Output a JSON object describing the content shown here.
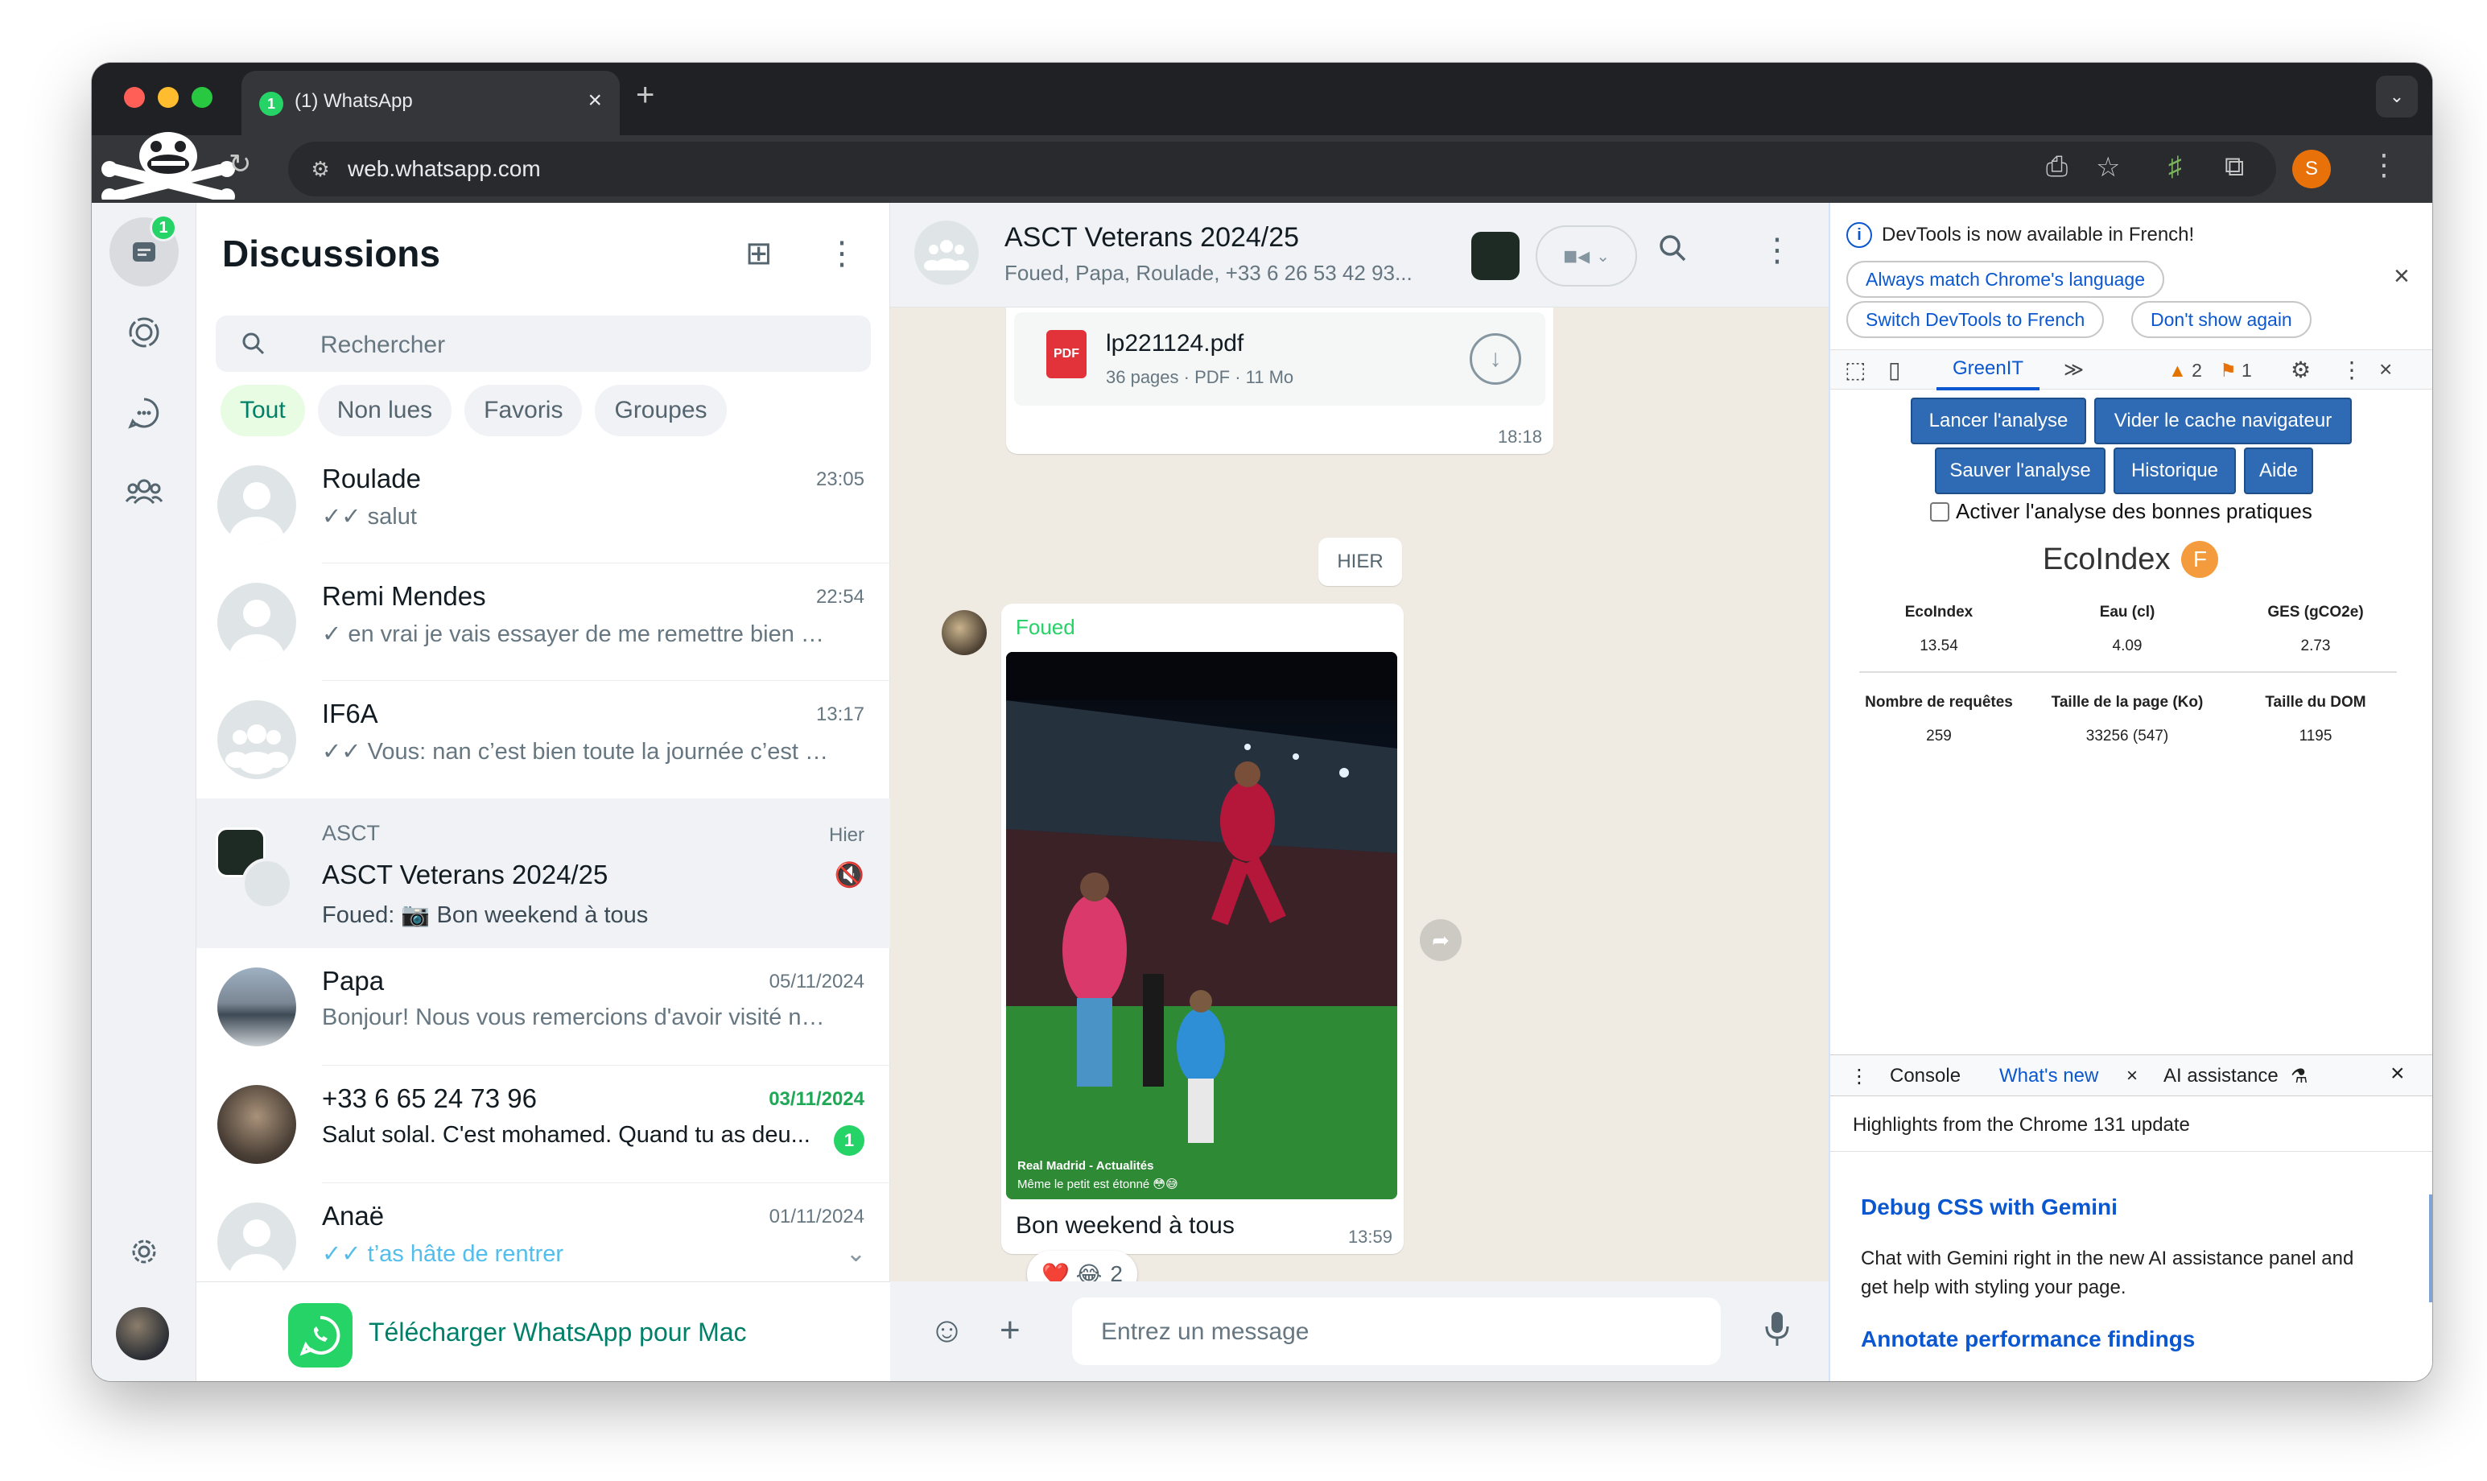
{
  "browser": {
    "tab_title": "(1) WhatsApp",
    "tab_badge": "1",
    "url": "web.whatsapp.com",
    "profile_initial": "S"
  },
  "rail": {
    "chats_badge": "1"
  },
  "chatlist": {
    "title": "Discussions",
    "search_placeholder": "Rechercher",
    "filters": [
      "Tout",
      "Non lues",
      "Favoris",
      "Groupes"
    ],
    "chats": [
      {
        "name": "Roulade",
        "time": "23:05",
        "preview": "✓✓ salut"
      },
      {
        "name": "Remi Mendes",
        "time": "22:54",
        "preview": "✓ en vrai je vais essayer de me remettre bien en..."
      },
      {
        "name": "IF6A",
        "time": "13:17",
        "preview": "✓✓ Vous: nan c’est bien toute la journée c’est ben..."
      },
      {
        "group_label": "ASCT",
        "name": "ASCT Veterans 2024/25",
        "time": "Hier",
        "preview": "Foued: 📷 Bon weekend à tous"
      },
      {
        "name": "Papa",
        "time": "05/11/2024",
        "preview": "Bonjour! Nous vous remercions d'avoir visité notr..."
      },
      {
        "name": "+33 6 65 24 73 96",
        "time": "03/11/2024",
        "preview": "Salut solal. C'est mohamed. Quand tu as deu...",
        "unread": "1"
      },
      {
        "name": "Anaë",
        "time": "01/11/2024",
        "preview": "✓✓ t’as hâte de rentrer"
      }
    ],
    "download_label": "Télécharger WhatsApp pour Mac"
  },
  "conversation": {
    "title": "ASCT Veterans 2024/25",
    "subtitle": "Foued, Papa, Roulade, +33 6 26 53 42 93...",
    "pdf": {
      "name": "lp221124.pdf",
      "meta": "36 pages · PDF · 11 Mo",
      "time": "18:18",
      "icon_label": "PDF"
    },
    "day_separator": "HIER",
    "message": {
      "sender": "Foued",
      "photo_caption_1": "Real Madrid - Actualités",
      "photo_caption_2": "Même le petit est étonné 😳😅",
      "text": "Bon weekend à tous",
      "time": "13:59",
      "reactions": "❤️ 😂",
      "reaction_count": "2"
    },
    "composer_placeholder": "Entrez un message"
  },
  "devtools": {
    "info_text": "DevTools is now available in French!",
    "btn_match": "Always match Chrome's language",
    "btn_switch": "Switch DevTools to French",
    "btn_dont_show": "Don't show again",
    "active_panel": "GreenIT",
    "warnings": "2",
    "issues": "1",
    "greenit": {
      "btn_launch": "Lancer l'analyse",
      "btn_clear_cache": "Vider le cache navigateur",
      "btn_save": "Sauver l'analyse",
      "btn_history": "Historique",
      "btn_help": "Aide",
      "checkbox_label": "Activer l'analyse des bonnes pratiques",
      "title": "EcoIndex",
      "grade": "F",
      "metrics": [
        {
          "label": "EcoIndex",
          "value": "13.54"
        },
        {
          "label": "Eau (cl)",
          "value": "4.09"
        },
        {
          "label": "GES (gCO2e)",
          "value": "2.73"
        },
        {
          "label": "Nombre de requêtes",
          "value": "259"
        },
        {
          "label": "Taille de la page (Ko)",
          "value": "33256 (547)"
        },
        {
          "label": "Taille du DOM",
          "value": "1195"
        }
      ]
    },
    "drawer": {
      "tabs": [
        "Console",
        "What's new",
        "AI assistance"
      ],
      "subtitle": "Highlights from the Chrome 131 update",
      "heading1": "Debug CSS with Gemini",
      "body1": "Chat with Gemini right in the new AI assistance panel and get help with styling your page.",
      "heading2": "Annotate performance findings"
    }
  }
}
